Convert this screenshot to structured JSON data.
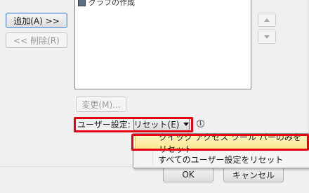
{
  "left_buttons": {
    "add_label": "追加(A) >>",
    "remove_label": "<< 削除(R)"
  },
  "listbox": {
    "visible_item": "グラフの作成",
    "item_icon": "toolbar-command-icon"
  },
  "reorder": {
    "up_icon": "triangle-up-icon",
    "down_icon": "triangle-down-icon"
  },
  "modify_label": "変更(M)...",
  "user_settings": {
    "label": "ユーザー設定:",
    "reset_label": "リセット(E)",
    "info_icon": "info-icon",
    "info_glyph": "i"
  },
  "reset_menu": {
    "items": [
      "クイック アクセス ツール バーのみをリセット",
      "すべてのユーザー設定をリセット"
    ],
    "highlighted_index": 0
  },
  "footer": {
    "ok_label": "OK",
    "cancel_label": "キャンセル"
  },
  "colors": {
    "highlight_box": "#e60012",
    "menu_hover": "#fce48a",
    "dialog_bg": "#f0f0f0"
  }
}
